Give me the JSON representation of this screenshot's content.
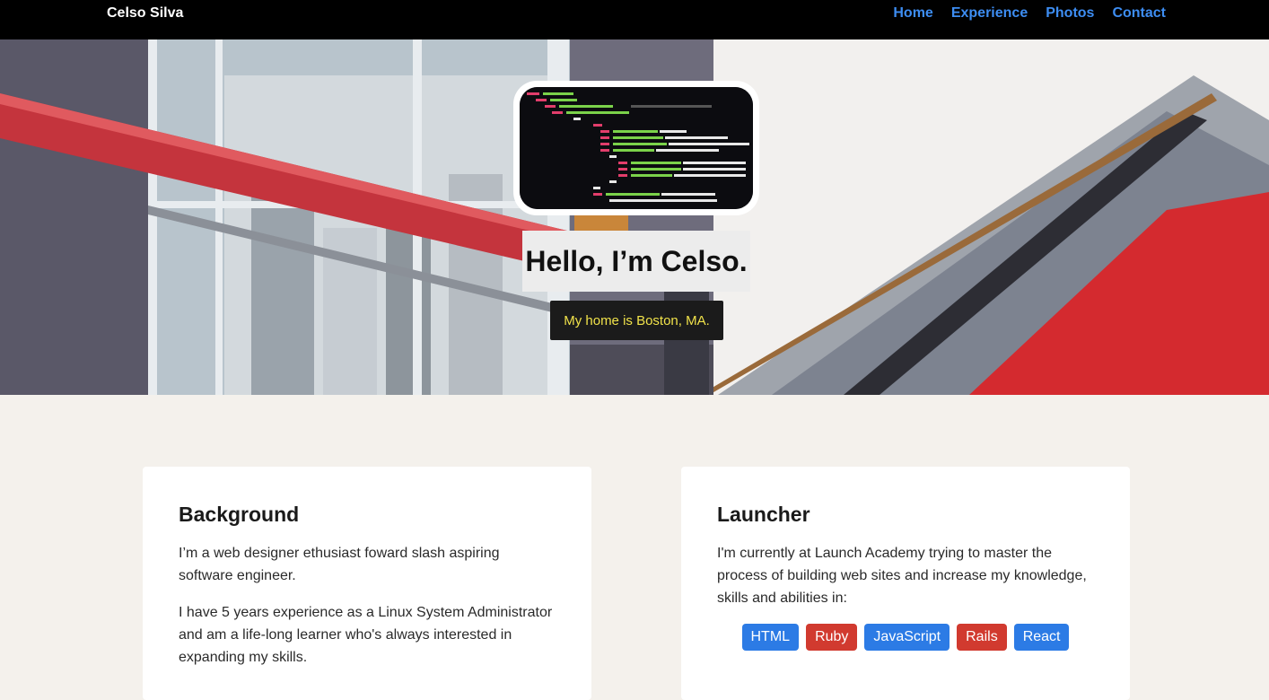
{
  "nav": {
    "brand": "Celso Silva",
    "links": [
      "Home",
      "Experience",
      "Photos",
      "Contact"
    ]
  },
  "hero": {
    "title": "Hello, I’m Celso.",
    "subtitle": "My home is Boston, MA."
  },
  "background_card": {
    "heading": "Background",
    "p1": "I’m a web designer ethusiast foward slash aspiring software engineer.",
    "p2": "I have 5 years experience as a Linux System Administrator and am a life-long learner who's always interested in expanding my skills."
  },
  "launcher_card": {
    "heading": "Launcher",
    "p1": "I'm currently at Launch Academy trying to master the process of building web sites and increase my knowledge, skills and abilities in:",
    "tags": [
      {
        "label": "HTML",
        "color": "#2c7be5"
      },
      {
        "label": "Ruby",
        "color": "#d13a2f"
      },
      {
        "label": "JavaScript",
        "color": "#2c7be5"
      },
      {
        "label": "Rails",
        "color": "#d13a2f"
      },
      {
        "label": "React",
        "color": "#2c7be5"
      }
    ]
  },
  "colors": {
    "nav_bg": "#000000",
    "link": "#3d8df2",
    "page_bg": "#f4f1ec",
    "subtitle_text": "#f0e24a"
  }
}
